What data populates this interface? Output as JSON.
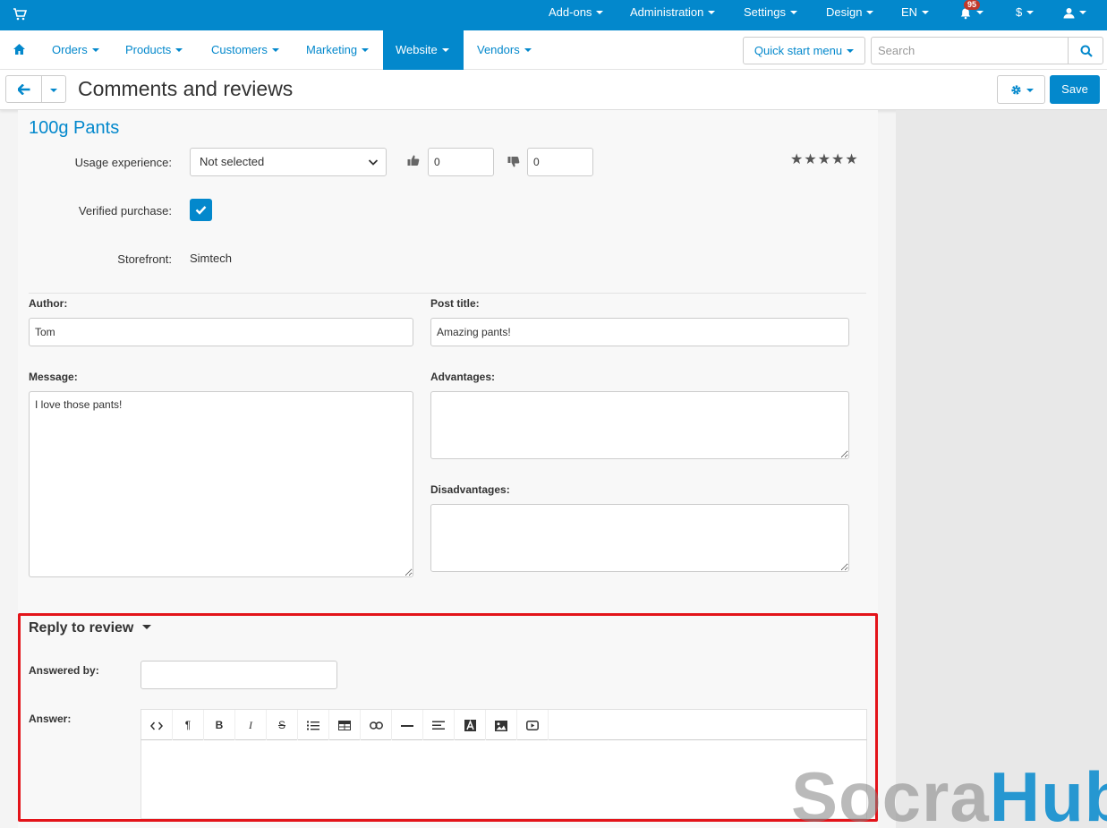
{
  "topbar": {
    "menus": [
      "Add-ons",
      "Administration",
      "Settings",
      "Design",
      "EN"
    ],
    "notifications_count": "95",
    "currency": "$"
  },
  "navbar": {
    "items": [
      "Orders",
      "Products",
      "Customers",
      "Marketing",
      "Website",
      "Vendors"
    ],
    "active": "Website",
    "quick_start": "Quick start menu",
    "search_placeholder": "Search"
  },
  "header": {
    "title": "Comments and reviews",
    "save_label": "Save"
  },
  "review": {
    "product": "100g Pants",
    "usage_label": "Usage experience:",
    "usage_value": "Not selected",
    "likes": "0",
    "dislikes": "0",
    "stars": "★★★★★",
    "verified_label": "Verified purchase:",
    "verified": true,
    "storefront_label": "Storefront:",
    "storefront_value": "Simtech",
    "author_label": "Author:",
    "author_value": "Tom",
    "post_title_label": "Post title:",
    "post_title_value": "Amazing pants!",
    "message_label": "Message:",
    "message_value": "I love those pants!",
    "advantages_label": "Advantages:",
    "advantages_value": "",
    "disadvantages_label": "Disadvantages:",
    "disadvantages_value": ""
  },
  "reply": {
    "title": "Reply to review",
    "answered_by_label": "Answered by:",
    "answered_by_value": "",
    "answer_label": "Answer:",
    "toolbar": [
      {
        "name": "code-view",
        "glyph": "<>"
      },
      {
        "name": "paragraph",
        "glyph": "¶"
      },
      {
        "name": "bold",
        "glyph": "B"
      },
      {
        "name": "italic",
        "glyph": "I"
      },
      {
        "name": "strikethrough",
        "glyph": "S"
      },
      {
        "name": "list",
        "glyph": "list"
      },
      {
        "name": "table",
        "glyph": "table"
      },
      {
        "name": "link",
        "glyph": "link"
      },
      {
        "name": "horizontal-rule",
        "glyph": "hr"
      },
      {
        "name": "align",
        "glyph": "align"
      },
      {
        "name": "font-color",
        "glyph": "A"
      },
      {
        "name": "image",
        "glyph": "image"
      },
      {
        "name": "video",
        "glyph": "video"
      }
    ]
  },
  "watermark": {
    "part1": "Socra",
    "part2": "Hub"
  },
  "colors": {
    "primary": "#0388cc",
    "highlight": "#e3141a"
  }
}
